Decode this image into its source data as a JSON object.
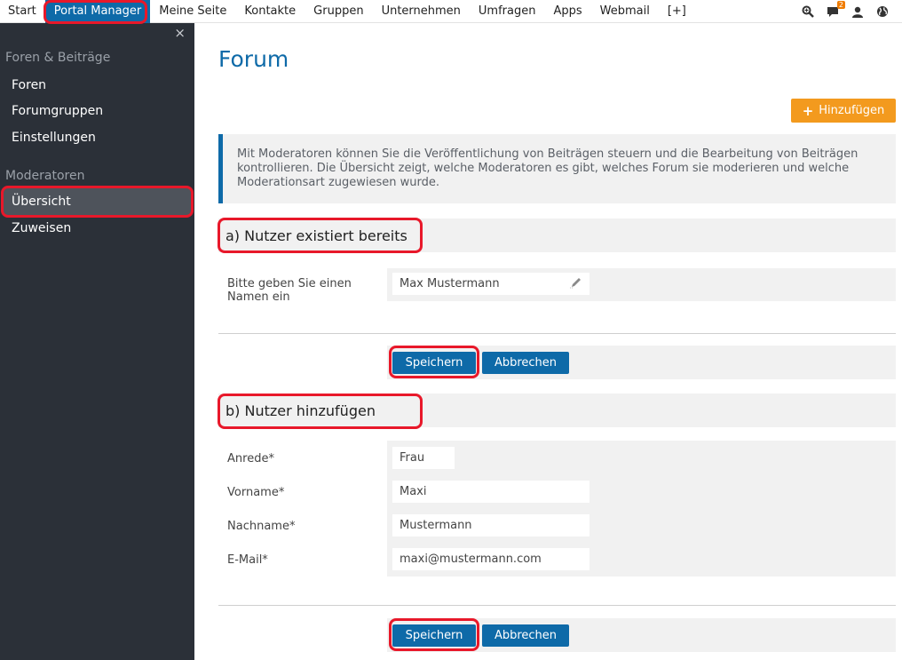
{
  "topnav": {
    "items": [
      "Start",
      "Portal Manager",
      "Meine Seite",
      "Kontakte",
      "Gruppen",
      "Unternehmen",
      "Umfragen",
      "Apps",
      "Webmail",
      "[+]"
    ],
    "active": "Portal Manager",
    "icons": [
      "search-icon",
      "chat-icon",
      "user-icon",
      "globe-icon"
    ],
    "chat_badge": "2"
  },
  "sidebar": {
    "close_glyph": "×",
    "group1_heading": "Foren & Beiträge",
    "group1_items": [
      "Foren",
      "Forumgruppen",
      "Einstellungen"
    ],
    "group2_heading": "Moderatoren",
    "group2_items": [
      "Übersicht",
      "Zuweisen"
    ],
    "selected": "Übersicht"
  },
  "main": {
    "title": "Forum",
    "add_button": "Hinzufügen",
    "info_text": "Mit Moderatoren können Sie die Veröffentlichung von Beiträgen steuern und die Bearbeitung von Beiträgen kontrollieren. Die Übersicht zeigt, welche Moderatoren es gibt, welches Forum sie moderieren und welche Moderationsart zugewiesen wurde.",
    "section_a": {
      "title": "a) Nutzer existiert bereits",
      "label": "Bitte geben Sie einen Namen ein",
      "value": "Max Mustermann",
      "save": "Speichern",
      "cancel": "Abbrechen"
    },
    "section_b": {
      "title": "b) Nutzer hinzufügen",
      "fields": [
        {
          "label": "Anrede*",
          "value": "Frau"
        },
        {
          "label": "Vorname*",
          "value": "Maxi"
        },
        {
          "label": "Nachname*",
          "value": "Mustermann"
        },
        {
          "label": "E-Mail*",
          "value": "maxi@mustermann.com"
        }
      ],
      "save": "Speichern",
      "cancel": "Abbrechen"
    }
  },
  "colors": {
    "accent_blue": "#0e6aa8",
    "add_orange": "#f39a1e",
    "sidebar_bg": "#2b3038",
    "highlight_red": "#e8182a"
  }
}
